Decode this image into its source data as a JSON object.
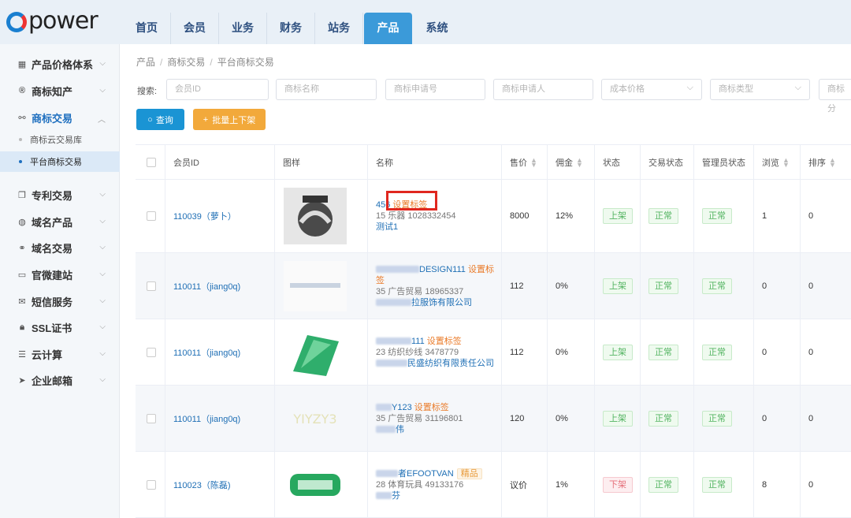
{
  "brand": "power",
  "nav": {
    "items": [
      "首页",
      "会员",
      "业务",
      "财务",
      "站务",
      "产品",
      "系统"
    ],
    "active_index": 5
  },
  "sidebar": {
    "groups": [
      {
        "label": "产品价格体系",
        "icon": "table-icon"
      },
      {
        "label": "商标知产",
        "icon": "registered-icon"
      },
      {
        "label": "商标交易",
        "icon": "handshake-icon",
        "expanded": true,
        "children": [
          "商标云交易库",
          "平台商标交易"
        ],
        "active_child": 1
      },
      {
        "label": "专利交易",
        "icon": "copy-icon"
      },
      {
        "label": "域名产品",
        "icon": "globe-icon"
      },
      {
        "label": "域名交易",
        "icon": "link-icon"
      },
      {
        "label": "官微建站",
        "icon": "monitor-icon"
      },
      {
        "label": "短信服务",
        "icon": "envelope-icon"
      },
      {
        "label": "SSL证书",
        "icon": "lock-icon"
      },
      {
        "label": "云计算",
        "icon": "server-icon"
      },
      {
        "label": "企业邮箱",
        "icon": "send-icon"
      }
    ]
  },
  "breadcrumb": [
    "产品",
    "商标交易",
    "平台商标交易"
  ],
  "search": {
    "label": "搜索:",
    "placeholders": [
      "会员ID",
      "商标名称",
      "商标申请号",
      "商标申请人",
      "成本价格",
      "商标类型",
      "商标分"
    ]
  },
  "buttons": {
    "query": "查询",
    "batch": "批量上下架"
  },
  "table": {
    "headers": [
      "会员ID",
      "图样",
      "名称",
      "售价",
      "佣金",
      "状态",
      "交易状态",
      "管理员状态",
      "浏览",
      "排序"
    ],
    "set_tag_label": "设置标签",
    "rows": [
      {
        "member": "110039（萝卜）",
        "name_line1": "456",
        "has_set_tag": true,
        "premium": "",
        "name_line2": "15 乐器 1028332454",
        "name_line3": "测试1",
        "price": "8000",
        "commission": "12%",
        "status": "上架",
        "status_color": "green",
        "trade_status": "正常",
        "admin_status": "正常",
        "views": "1",
        "sort": "0"
      },
      {
        "member": "110011（jiang0q)",
        "name_line1": "DESIGN111",
        "has_set_tag": true,
        "premium": "",
        "name_line2": "35 广告贸易 18965337",
        "name_line3": "拉服饰有限公司",
        "price": "112",
        "commission": "0%",
        "status": "上架",
        "status_color": "green",
        "trade_status": "正常",
        "admin_status": "正常",
        "views": "0",
        "sort": "0"
      },
      {
        "member": "110011（jiang0q)",
        "name_line1": "111",
        "has_set_tag": true,
        "premium": "",
        "name_line2": "23 纺织纱线 3478779",
        "name_line3": "民盛纺织有限责任公司",
        "price": "112",
        "commission": "0%",
        "status": "上架",
        "status_color": "green",
        "trade_status": "正常",
        "admin_status": "正常",
        "views": "0",
        "sort": "0"
      },
      {
        "member": "110011（jiang0q)",
        "name_line1": "Y123",
        "has_set_tag": true,
        "premium": "",
        "name_line2": "35 广告贸易 31196801",
        "name_line3": "伟",
        "price": "120",
        "commission": "0%",
        "status": "上架",
        "status_color": "green",
        "trade_status": "正常",
        "admin_status": "正常",
        "views": "0",
        "sort": "0"
      },
      {
        "member": "110023（陈磊)",
        "name_line1": "者EFOOTVAN",
        "has_set_tag": false,
        "premium": "精品",
        "name_line2": "28 体育玩具 49133176",
        "name_line3": "芬",
        "price": "议价",
        "commission": "1%",
        "status": "下架",
        "status_color": "red",
        "trade_status": "正常",
        "admin_status": "正常",
        "views": "8",
        "sort": "0"
      }
    ]
  },
  "colors": {
    "accent": "#3b9ad9",
    "query_button": "#1a94d4",
    "batch_button": "#f2a93b",
    "tag_orange": "#ea7b29",
    "highlight_red": "#e0271f"
  }
}
